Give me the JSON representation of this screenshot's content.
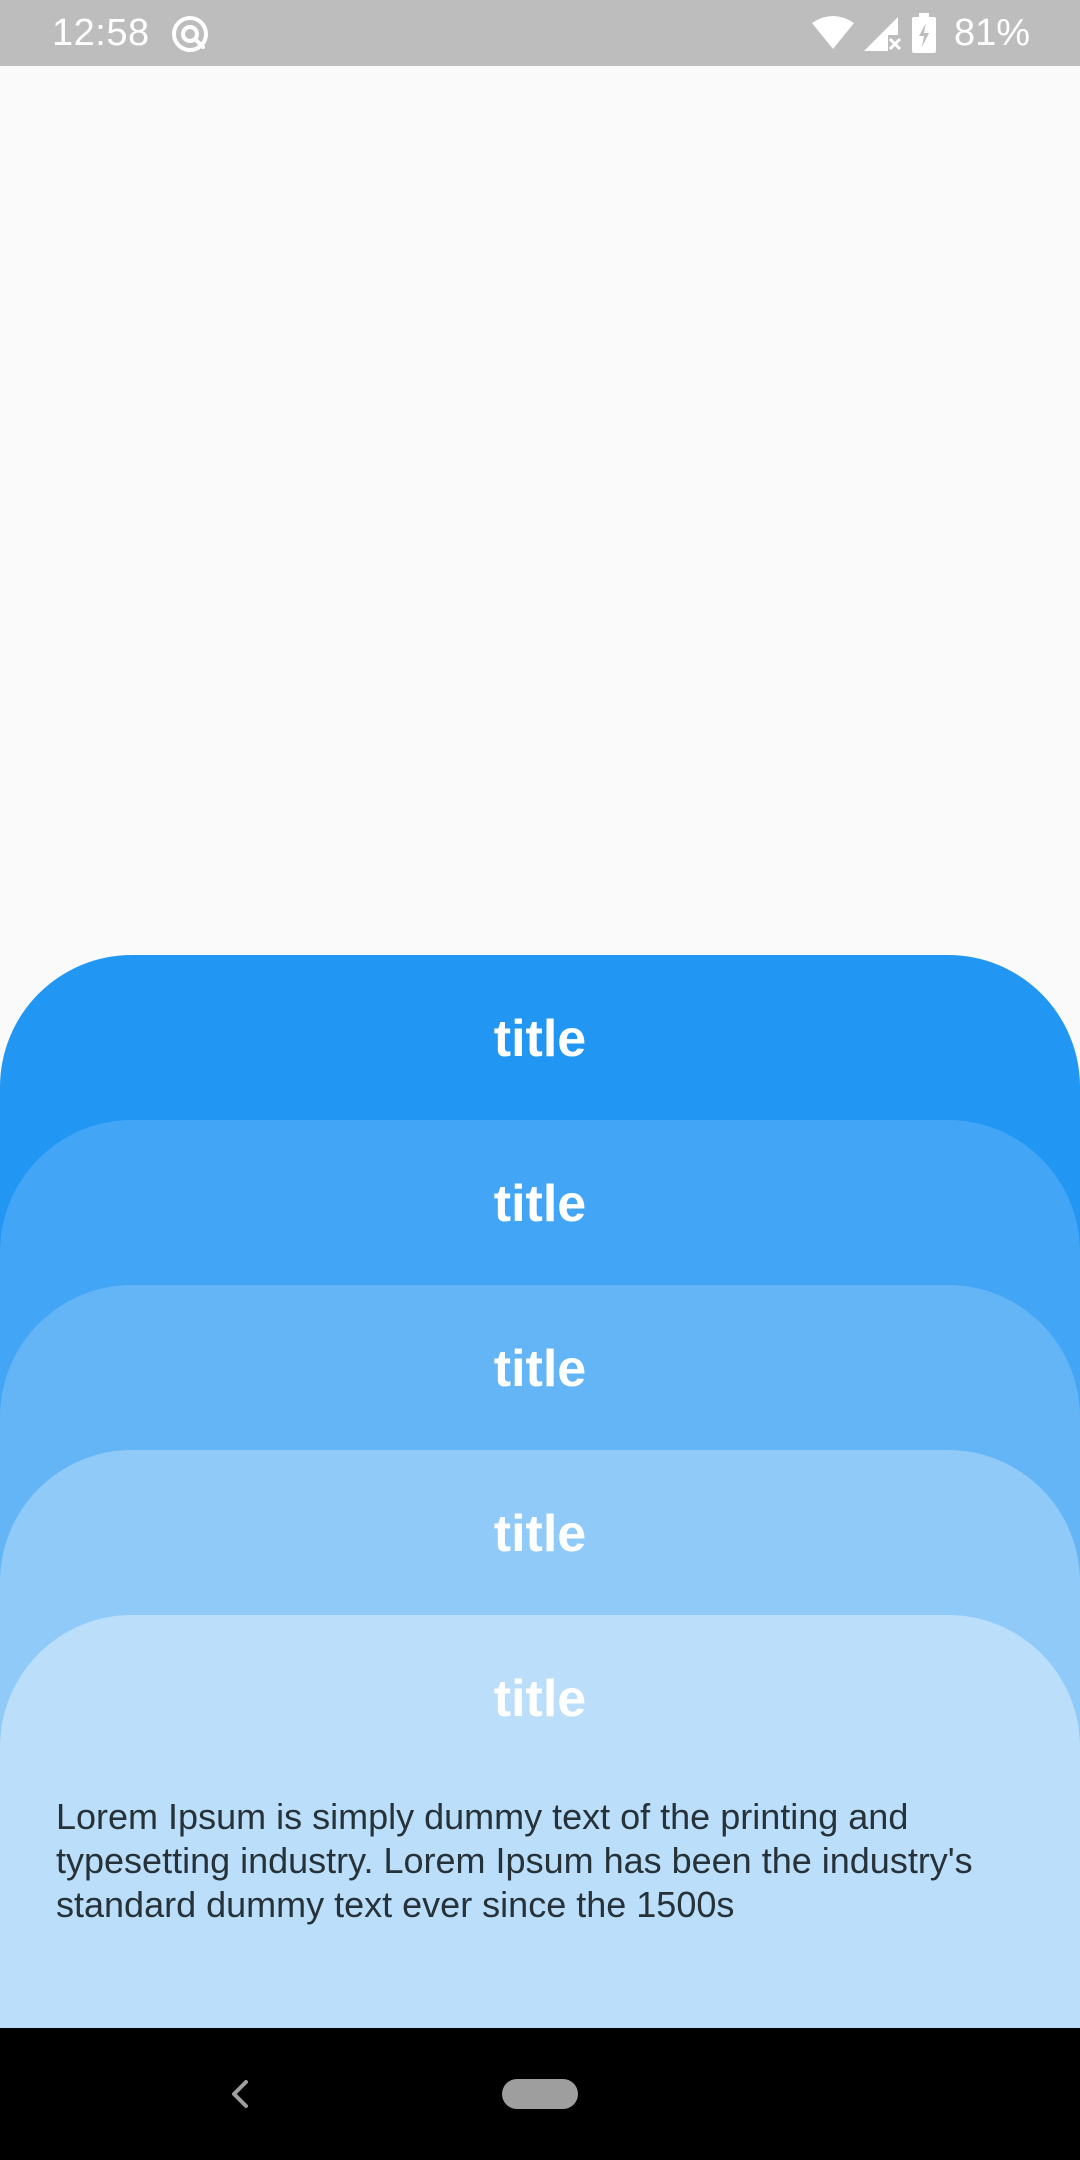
{
  "status_bar": {
    "time": "12:58",
    "app_icon": "sync-circle-icon",
    "wifi_icon": "wifi-icon",
    "signal_icon": "signal-no-data-icon",
    "battery_icon": "battery-charging-icon",
    "battery_percent": "81%"
  },
  "cards": [
    {
      "title": "title",
      "color": "#2196F3"
    },
    {
      "title": "title",
      "color": "#42A5F5"
    },
    {
      "title": "title",
      "color": "#64B5F6"
    },
    {
      "title": "title",
      "color": "#90CAF9"
    },
    {
      "title": "title",
      "color": "#BBDEFB",
      "body": "Lorem Ipsum is simply dummy text of the printing and typesetting industry. Lorem Ipsum has been the industry's standard dummy text ever since the 1500s"
    }
  ],
  "nav_bar": {
    "back_icon": "back-chevron-icon",
    "home_icon": "home-pill-icon"
  }
}
